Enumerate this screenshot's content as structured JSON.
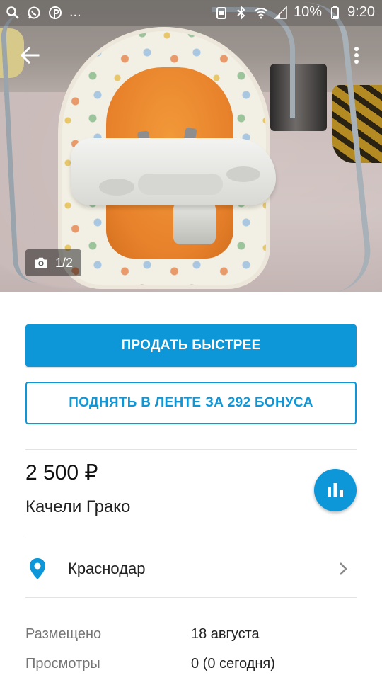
{
  "status_bar": {
    "left_icons": [
      "search-icon",
      "whatsapp-icon",
      "pinterest-icon"
    ],
    "overflow_dots": "...",
    "battery": "10%",
    "time": "9:20"
  },
  "gallery": {
    "counter": "1/2"
  },
  "actions": {
    "sell_faster": "ПРОДАТЬ БЫСТРЕЕ",
    "boost": "ПОДНЯТЬ В ЛЕНТЕ ЗА 292 БОНУСА"
  },
  "listing": {
    "price": "2 500 ₽",
    "title": "Качели Грако"
  },
  "location": {
    "city": "Краснодар"
  },
  "info": {
    "posted_label": "Размещено",
    "posted_value": "18 августа",
    "views_label": "Просмотры",
    "views_value": "0 (0 сегодня)"
  },
  "colors": {
    "accent": "#0d96d8"
  }
}
